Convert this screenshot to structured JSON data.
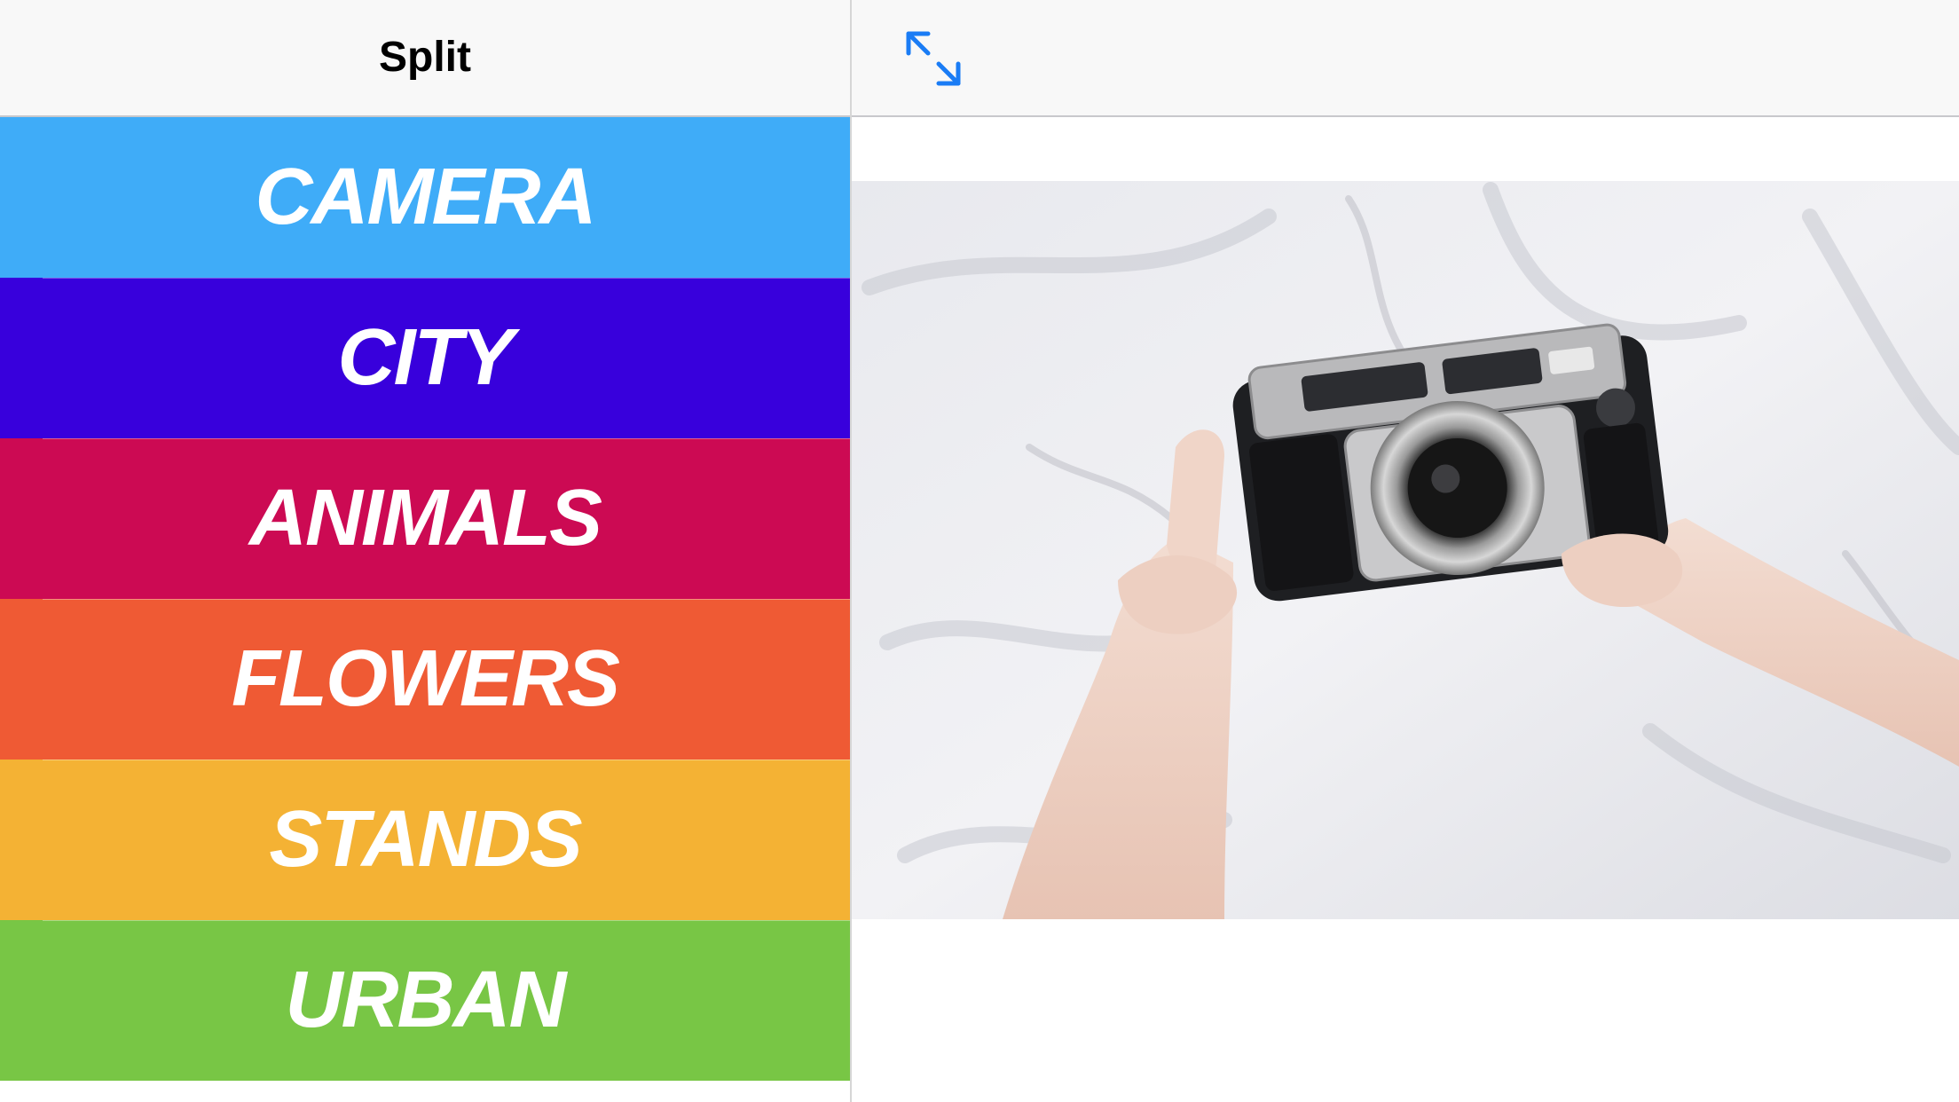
{
  "master": {
    "title": "Split",
    "rows": [
      {
        "label": "CAMERA",
        "color": "#3FACF8"
      },
      {
        "label": "CITY",
        "color": "#3800DC"
      },
      {
        "label": "ANIMALS",
        "color": "#CC0A53"
      },
      {
        "label": "FLOWERS",
        "color": "#EF5A34"
      },
      {
        "label": "STANDS",
        "color": "#F4B234"
      },
      {
        "label": "URBAN",
        "color": "#78C645"
      }
    ]
  },
  "detail": {
    "expand_icon": "arrows-expand-icon",
    "accent": "#1A7CF5",
    "photo_icon": "camera-in-hands-photo"
  }
}
